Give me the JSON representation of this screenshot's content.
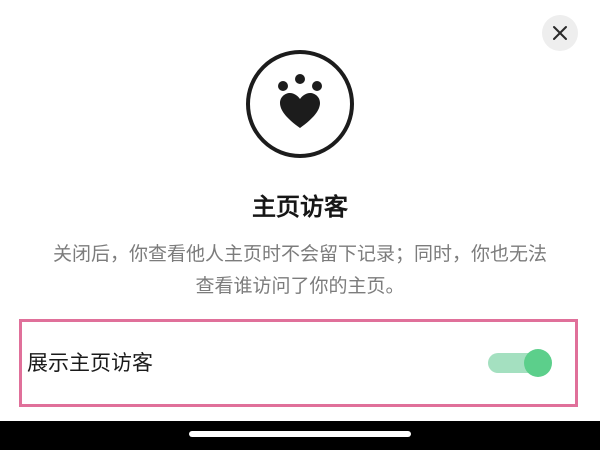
{
  "dialog": {
    "close_icon": "close-icon",
    "emblem_icon": "paw-heart-icon",
    "title": "主页访客",
    "description_lines": [
      "关闭后，你查看他人主页时不会留下记录；同时，你也无法",
      "查看谁访问了你的主页。"
    ]
  },
  "setting": {
    "label": "展示主页访客",
    "toggle_on": true
  },
  "colors": {
    "toggle_knob": "#5ccf8b",
    "toggle_track": "#a4e0c0",
    "highlight_border": "#e0709a",
    "emblem": "#1c1c1c"
  }
}
